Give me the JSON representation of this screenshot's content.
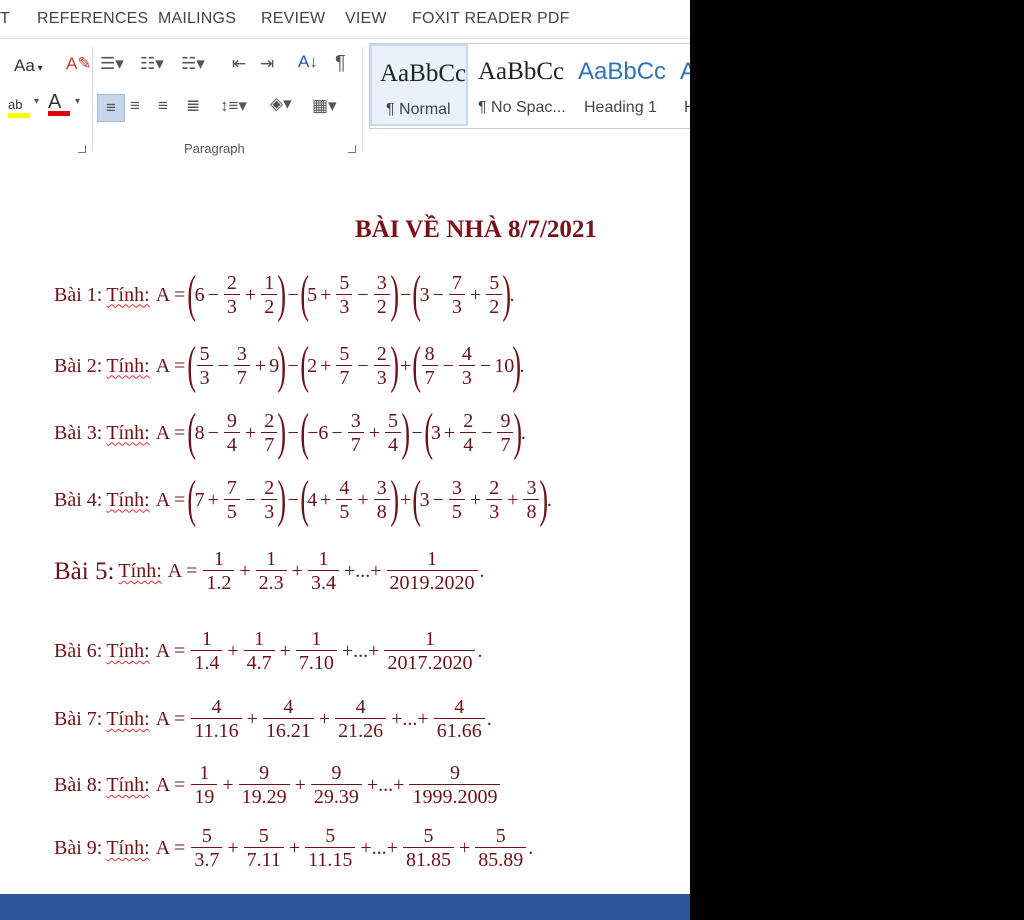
{
  "menu": {
    "tabs": [
      "T",
      "REFERENCES",
      "MAILINGS",
      "REVIEW",
      "VIEW",
      "FOXIT READER PDF"
    ]
  },
  "ribbon": {
    "font_size_label": "Aa",
    "paragraph_group_label": "Paragraph",
    "styles": [
      {
        "sample": "AaBbCc",
        "name": "¶ Normal",
        "color": "#222222"
      },
      {
        "sample": "AaBbCc",
        "name": "¶ No Spac...",
        "color": "#222222"
      },
      {
        "sample": "AaBbCc",
        "name": "Heading 1",
        "color": "#2e74b5"
      },
      {
        "sample": "A",
        "name": "H",
        "color": "#2e74b5"
      }
    ],
    "colors": {
      "highlight": "#ffff00",
      "font_color": "#e00000",
      "accent": "#2b579a"
    }
  },
  "document": {
    "title": "BÀI VỀ NHÀ 8/7/2021",
    "problem_prefix_tinh": "Tính:",
    "problems": [
      {
        "label": "Bài 1:",
        "expr": [
          {
            "p": "("
          },
          {
            "t": "6"
          },
          {
            "o": "−"
          },
          {
            "f": [
              "2",
              "3"
            ]
          },
          {
            "o": "+"
          },
          {
            "f": [
              "1",
              "2"
            ]
          },
          {
            "p": ")"
          },
          {
            "o": "−"
          },
          {
            "p": "("
          },
          {
            "t": "5"
          },
          {
            "o": "+"
          },
          {
            "f": [
              "5",
              "3"
            ]
          },
          {
            "o": "−"
          },
          {
            "f": [
              "3",
              "2"
            ]
          },
          {
            "p": ")"
          },
          {
            "o": "−"
          },
          {
            "p": "("
          },
          {
            "t": "3"
          },
          {
            "o": "−"
          },
          {
            "f": [
              "7",
              "3"
            ]
          },
          {
            "o": "+"
          },
          {
            "f": [
              "5",
              "2"
            ]
          },
          {
            "p": ")"
          },
          {
            "t": "."
          }
        ]
      },
      {
        "label": "Bài 2:",
        "expr": [
          {
            "p": "("
          },
          {
            "f": [
              "5",
              "3"
            ]
          },
          {
            "o": "−"
          },
          {
            "f": [
              "3",
              "7"
            ]
          },
          {
            "o": "+"
          },
          {
            "t": "9"
          },
          {
            "p": ")"
          },
          {
            "o": "−"
          },
          {
            "p": "("
          },
          {
            "t": "2"
          },
          {
            "o": "+"
          },
          {
            "f": [
              "5",
              "7"
            ]
          },
          {
            "o": "−"
          },
          {
            "f": [
              "2",
              "3"
            ]
          },
          {
            "p": ")"
          },
          {
            "o": "+"
          },
          {
            "p": "("
          },
          {
            "f": [
              "8",
              "7"
            ]
          },
          {
            "o": "−"
          },
          {
            "f": [
              "4",
              "3"
            ]
          },
          {
            "o": "−"
          },
          {
            "t": "10"
          },
          {
            "p": ")"
          },
          {
            "t": "."
          }
        ]
      },
      {
        "label": "Bài 3:",
        "expr": [
          {
            "p": "("
          },
          {
            "t": "8"
          },
          {
            "o": "−"
          },
          {
            "f": [
              "9",
              "4"
            ]
          },
          {
            "o": "+"
          },
          {
            "f": [
              "2",
              "7"
            ]
          },
          {
            "p": ")"
          },
          {
            "o": "−"
          },
          {
            "p": "("
          },
          {
            "t": "−6"
          },
          {
            "o": "−"
          },
          {
            "f": [
              "3",
              "7"
            ]
          },
          {
            "o": "+"
          },
          {
            "f": [
              "5",
              "4"
            ]
          },
          {
            "p": ")"
          },
          {
            "o": "−"
          },
          {
            "p": "("
          },
          {
            "t": "3"
          },
          {
            "o": "+"
          },
          {
            "f": [
              "2",
              "4"
            ]
          },
          {
            "o": "−"
          },
          {
            "f": [
              "9",
              "7"
            ]
          },
          {
            "p": ")"
          },
          {
            "t": "."
          }
        ]
      },
      {
        "label": "Bài 4:",
        "expr": [
          {
            "p": "("
          },
          {
            "t": "7"
          },
          {
            "o": "+"
          },
          {
            "f": [
              "7",
              "5"
            ]
          },
          {
            "o": "−"
          },
          {
            "f": [
              "2",
              "3"
            ]
          },
          {
            "p": ")"
          },
          {
            "o": "−"
          },
          {
            "p": "("
          },
          {
            "t": "4"
          },
          {
            "o": "+"
          },
          {
            "f": [
              "4",
              "5"
            ]
          },
          {
            "o": "+"
          },
          {
            "f": [
              "3",
              "8"
            ]
          },
          {
            "p": ")"
          },
          {
            "o": "+"
          },
          {
            "p": "("
          },
          {
            "t": "3"
          },
          {
            "o": "−"
          },
          {
            "f": [
              "3",
              "5"
            ]
          },
          {
            "o": "+"
          },
          {
            "f": [
              "2",
              "3"
            ]
          },
          {
            "o": "+"
          },
          {
            "f": [
              "3",
              "8"
            ]
          },
          {
            "p": ")"
          },
          {
            "t": "."
          }
        ]
      },
      {
        "label": "Bài 5:",
        "big": true,
        "expr": [
          {
            "f": [
              "1",
              "1.2"
            ]
          },
          {
            "o": "+"
          },
          {
            "f": [
              "1",
              "2.3"
            ]
          },
          {
            "o": "+"
          },
          {
            "f": [
              "1",
              "3.4"
            ]
          },
          {
            "o": "+...+"
          },
          {
            "f": [
              "1",
              "2019.2020"
            ]
          },
          {
            "t": "."
          }
        ]
      },
      {
        "label": "Bài 6:",
        "expr": [
          {
            "f": [
              "1",
              "1.4"
            ]
          },
          {
            "o": "+"
          },
          {
            "f": [
              "1",
              "4.7"
            ]
          },
          {
            "o": "+"
          },
          {
            "f": [
              "1",
              "7.10"
            ]
          },
          {
            "o": "+...+"
          },
          {
            "f": [
              "1",
              "2017.2020"
            ]
          },
          {
            "t": "."
          }
        ]
      },
      {
        "label": "Bài 7:",
        "expr": [
          {
            "f": [
              "4",
              "11.16"
            ]
          },
          {
            "o": "+"
          },
          {
            "f": [
              "4",
              "16.21"
            ]
          },
          {
            "o": "+"
          },
          {
            "f": [
              "4",
              "21.26"
            ]
          },
          {
            "o": "+...+"
          },
          {
            "f": [
              "4",
              "61.66"
            ]
          },
          {
            "t": "."
          }
        ]
      },
      {
        "label": "Bài 8:",
        "expr": [
          {
            "f": [
              "1",
              "19"
            ]
          },
          {
            "o": "+"
          },
          {
            "f": [
              "9",
              "19.29"
            ]
          },
          {
            "o": "+"
          },
          {
            "f": [
              "9",
              "29.39"
            ]
          },
          {
            "o": "+...+"
          },
          {
            "f": [
              "9",
              "1999.2009"
            ]
          }
        ]
      },
      {
        "label": "Bài 9:",
        "expr": [
          {
            "f": [
              "5",
              "3.7"
            ]
          },
          {
            "o": "+"
          },
          {
            "f": [
              "5",
              "7.11"
            ]
          },
          {
            "o": "+"
          },
          {
            "f": [
              "5",
              "11.15"
            ]
          },
          {
            "o": "+...+"
          },
          {
            "f": [
              "5",
              "81.85"
            ]
          },
          {
            "o": "+"
          },
          {
            "f": [
              "5",
              "85.89"
            ]
          },
          {
            "t": "."
          }
        ]
      }
    ]
  }
}
